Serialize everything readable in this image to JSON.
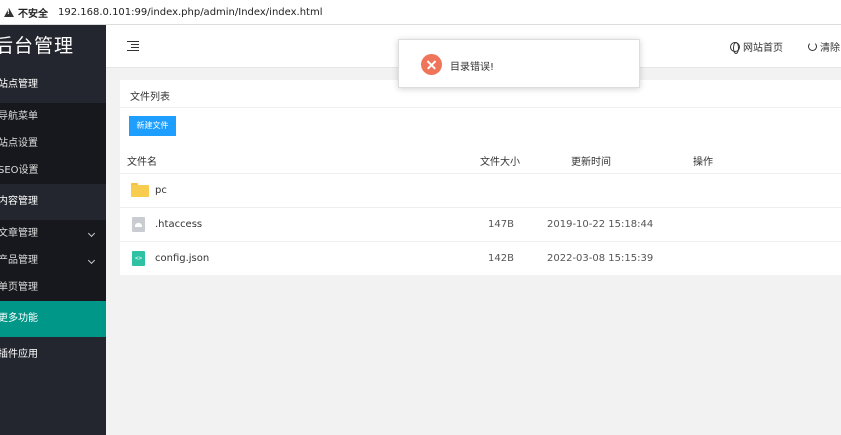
{
  "browser": {
    "security_label": "不安全",
    "url": "192.168.0.101:99/index.php/admin/Index/index.html"
  },
  "sidebar": {
    "brand": "后台管理",
    "items": [
      {
        "type": "group",
        "label": "站点管理"
      },
      {
        "type": "sub",
        "label": "导航菜单"
      },
      {
        "type": "sub",
        "label": "站点设置"
      },
      {
        "type": "sub",
        "label": "SEO设置"
      },
      {
        "type": "group",
        "label": "内容管理"
      },
      {
        "type": "sub",
        "label": "文章管理"
      },
      {
        "type": "sub",
        "label": "产品管理"
      },
      {
        "type": "sub",
        "label": "单页管理"
      },
      {
        "type": "group",
        "label": "更多功能"
      },
      {
        "type": "group",
        "label": "插件应用"
      }
    ]
  },
  "topbar": {
    "menu_icon": "menu-fold-icon",
    "site_home_label": "网站首页",
    "clear_label": "清除"
  },
  "toast": {
    "icon": "error-icon",
    "color": "#f0745a",
    "message": "目录错误!"
  },
  "file_list": {
    "title": "文件列表",
    "new_button": "新建文件",
    "columns": [
      "文件名",
      "文件大小",
      "更新时间",
      "操作"
    ],
    "rows": [
      {
        "icon": "folder-icon",
        "name": "pc",
        "size": "",
        "time": ""
      },
      {
        "icon": "file-icon",
        "name": ".htaccess",
        "size": "147B",
        "time": "2019-10-22 15:18:44"
      },
      {
        "icon": "code-file-icon",
        "name": "config.json",
        "size": "142B",
        "time": "2022-03-08 15:15:39"
      }
    ]
  },
  "colors": {
    "sidebar_bg": "#23262e",
    "sidebar_active": "#009688",
    "button_primary": "#1e9fff"
  }
}
